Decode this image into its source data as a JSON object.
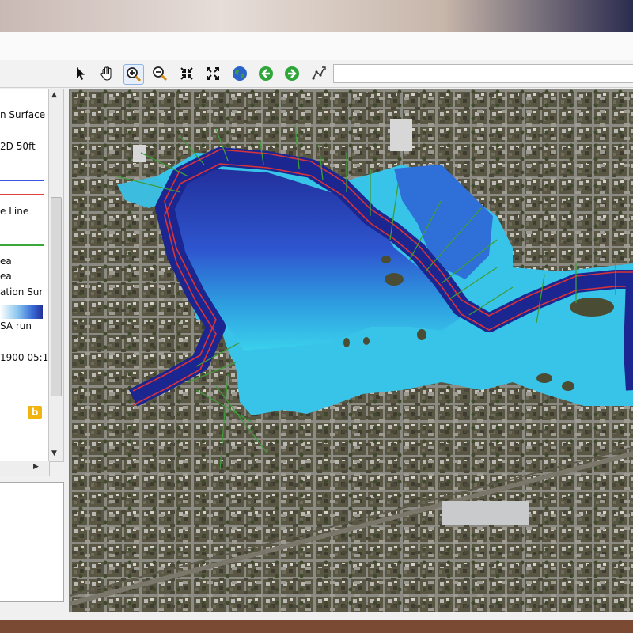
{
  "toolbar": {
    "tools": [
      {
        "icon": "pointer-icon"
      },
      {
        "icon": "hand-pan-icon"
      },
      {
        "icon": "zoom-in-icon"
      },
      {
        "icon": "zoom-out-icon"
      },
      {
        "icon": "zoom-extent-icon"
      },
      {
        "icon": "full-extent-icon"
      },
      {
        "icon": "globe-icon"
      },
      {
        "icon": "back-arrow-icon"
      },
      {
        "icon": "forward-arrow-icon"
      },
      {
        "icon": "measure-icon"
      }
    ]
  },
  "legend": {
    "items": [
      "n Surface",
      "2D 50ft",
      "e Line",
      "ea",
      "ea",
      "ation Sur",
      "SA run",
      "1900 05:1"
    ],
    "colors": {
      "blue_line": "#3a54e0",
      "red_line": "#e04040",
      "green_line": "#3aa83a"
    }
  },
  "map": {
    "colors": {
      "flood_deep": "#1c2a9e",
      "flood_mid": "#2f5fd6",
      "flood_shallow": "#34c2e6",
      "channel_line": "#d9333a",
      "cross_section": "#3e9c3a"
    }
  }
}
